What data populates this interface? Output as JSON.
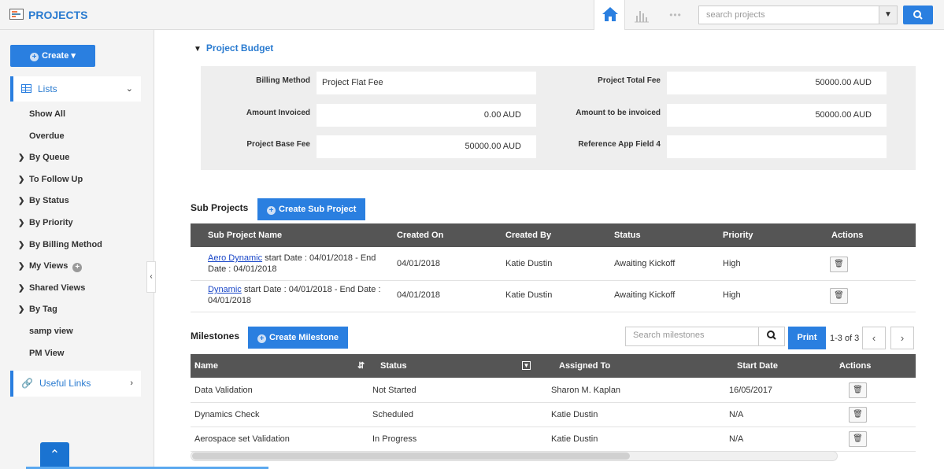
{
  "app": {
    "title": "PROJECTS"
  },
  "topbar": {
    "search_placeholder": "search projects",
    "more_icon": "•••"
  },
  "sidebar": {
    "create_label": "Create",
    "lists_label": "Lists",
    "items": [
      {
        "label": "Show All",
        "arrow": false
      },
      {
        "label": "Overdue",
        "arrow": false
      },
      {
        "label": "By Queue",
        "arrow": true
      },
      {
        "label": "To Follow Up",
        "arrow": true
      },
      {
        "label": "By Status",
        "arrow": true
      },
      {
        "label": "By Priority",
        "arrow": true
      },
      {
        "label": "By Billing Method",
        "arrow": true
      },
      {
        "label": "My Views",
        "arrow": true,
        "plus": true
      },
      {
        "label": "Shared Views",
        "arrow": true
      },
      {
        "label": "By Tag",
        "arrow": true
      },
      {
        "label": "samp view",
        "arrow": false
      },
      {
        "label": "PM View",
        "arrow": false
      }
    ],
    "useful_links_label": "Useful Links"
  },
  "budget": {
    "title": "Project Budget",
    "billing_method_label": "Billing Method",
    "billing_method_value": "Project Flat Fee",
    "amount_invoiced_label": "Amount Invoiced",
    "amount_invoiced_value": "0.00  AUD",
    "base_fee_label": "Project Base Fee",
    "base_fee_value": "50000.00  AUD",
    "total_fee_label": "Project Total Fee",
    "total_fee_value": "50000.00  AUD",
    "to_be_invoiced_label": "Amount to be invoiced",
    "to_be_invoiced_value": "50000.00  AUD",
    "ref_field_label": "Reference App Field 4",
    "ref_field_value": ""
  },
  "subprojects": {
    "title": "Sub Projects",
    "create_label": "Create Sub Project",
    "columns": [
      "Sub Project Name",
      "Created On",
      "Created By",
      "Status",
      "Priority",
      "Actions"
    ],
    "rows": [
      {
        "link": "Aero Dynamic",
        "rest": " start Date : 04/01/2018 - End Date : 04/01/2018",
        "created_on": "04/01/2018",
        "created_by": "Katie Dustin",
        "status": "Awaiting Kickoff",
        "priority": "High"
      },
      {
        "link": "Dynamic",
        "rest": " start Date : 04/01/2018 - End Date : 04/01/2018",
        "created_on": "04/01/2018",
        "created_by": "Katie Dustin",
        "status": "Awaiting Kickoff",
        "priority": "High"
      }
    ]
  },
  "milestones": {
    "title": "Milestones",
    "create_label": "Create Milestone",
    "search_placeholder": "Search milestones",
    "print_label": "Print",
    "pager": "1-3 of 3",
    "columns": [
      "Name",
      "Status",
      "Assigned To",
      "Start Date",
      "Actions"
    ],
    "rows": [
      {
        "name": "Data Validation",
        "status": "Not Started",
        "assigned": "Sharon M. Kaplan",
        "start": "16/05/2017"
      },
      {
        "name": "Dynamics Check",
        "status": "Scheduled",
        "assigned": "Katie Dustin",
        "start": "N/A"
      },
      {
        "name": "Aerospace set Validation",
        "status": "In Progress",
        "assigned": "Katie Dustin",
        "start": "N/A"
      }
    ]
  }
}
